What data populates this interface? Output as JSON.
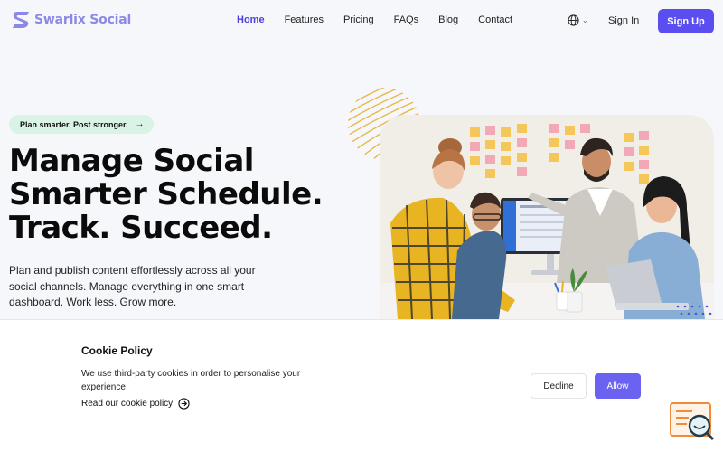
{
  "brand": {
    "name": "Swarlix Social"
  },
  "nav": {
    "items": [
      {
        "label": "Home",
        "active": true
      },
      {
        "label": "Features"
      },
      {
        "label": "Pricing"
      },
      {
        "label": "FAQs"
      },
      {
        "label": "Blog"
      },
      {
        "label": "Contact"
      }
    ],
    "language_icon": "globe-icon",
    "sign_in": "Sign In",
    "sign_up": "Sign Up"
  },
  "hero": {
    "badge": "Plan smarter. Post stronger.",
    "title_lines": [
      "Manage Social",
      "Smarter Schedule.",
      "Track. Succeed."
    ],
    "description": "Plan and publish content effortlessly across all your social channels. Manage everything in one smart dashboard. Work less. Grow more."
  },
  "cookie": {
    "title": "Cookie Policy",
    "text": "We use third-party cookies in order to personalise your experience",
    "link": "Read our cookie policy",
    "decline": "Decline",
    "allow": "Allow"
  },
  "colors": {
    "accent": "#5b4ef0",
    "brand_logo": "#8d88e6",
    "badge_bg": "#d9f4e6",
    "allow_button": "#6b62f2"
  }
}
